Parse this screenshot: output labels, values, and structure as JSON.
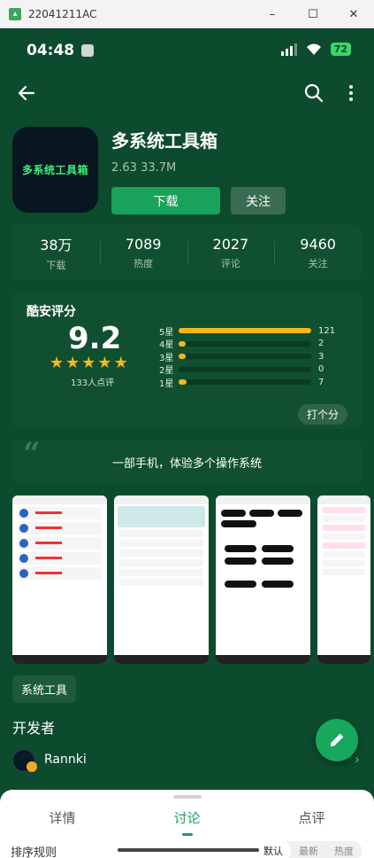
{
  "window": {
    "title": "22041211AC",
    "controls": [
      "–",
      "☐",
      "✕"
    ]
  },
  "statusbar": {
    "time": "04:48",
    "battery": "72"
  },
  "app": {
    "name": "多系统工具箱",
    "icon_text": "多系统工具箱",
    "version": "2.63",
    "size": "33.7M",
    "download_label": "下载",
    "follow_label": "关注"
  },
  "stats": [
    {
      "value": "38万",
      "label": "下载"
    },
    {
      "value": "7089",
      "label": "热度"
    },
    {
      "value": "2027",
      "label": "评论"
    },
    {
      "value": "9460",
      "label": "关注"
    }
  ],
  "rating": {
    "title": "酷安评分",
    "score": "9.2",
    "stars": 5,
    "count_text": "133人点评",
    "rate_button": "打个分",
    "rows": [
      {
        "label": "5星",
        "count": "121",
        "fraction": 1.0
      },
      {
        "label": "4星",
        "count": "2",
        "fraction": 0.017
      },
      {
        "label": "3星",
        "count": "3",
        "fraction": 0.025
      },
      {
        "label": "2星",
        "count": "0",
        "fraction": 0.0
      },
      {
        "label": "1星",
        "count": "7",
        "fraction": 0.058
      }
    ]
  },
  "description": {
    "text": "一部手机，体验多个操作系统"
  },
  "tag": "系统工具",
  "developer": {
    "heading": "开发者",
    "name": "Rannki"
  },
  "tabs": [
    {
      "label": "详情",
      "active": false
    },
    {
      "label": "讨论",
      "active": true
    },
    {
      "label": "点评",
      "active": false
    }
  ],
  "sort": {
    "label": "排序规则",
    "options": [
      {
        "label": "默认",
        "active": true
      },
      {
        "label": "最新",
        "active": false
      },
      {
        "label": "热度",
        "active": false
      }
    ]
  },
  "colors": {
    "background": "#0c4b2d",
    "accent": "#18a25a",
    "star": "#f6b81a",
    "card": "#114f31"
  }
}
